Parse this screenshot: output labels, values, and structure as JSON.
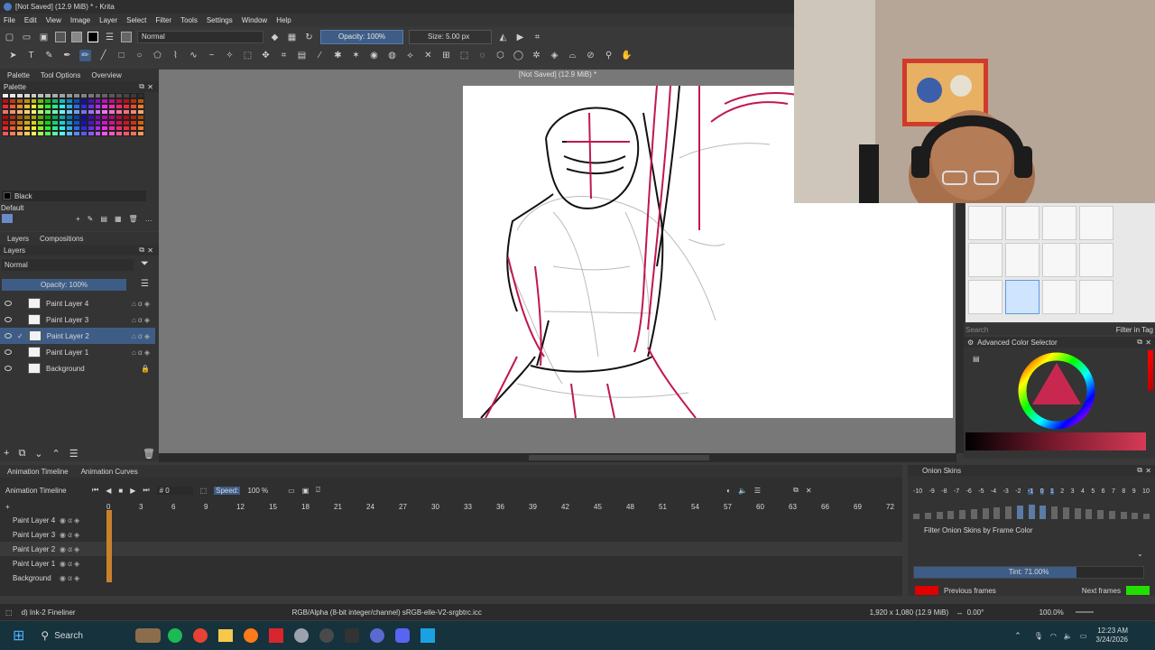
{
  "window": {
    "title": "[Not Saved]  (12.9 MiB) * - Krita"
  },
  "menu": [
    "File",
    "Edit",
    "View",
    "Image",
    "Layer",
    "Select",
    "Filter",
    "Tools",
    "Settings",
    "Window",
    "Help"
  ],
  "toolbar": {
    "blend_mode": "Normal",
    "opacity": "Opacity: 100%",
    "size": "Size: 5.00 px"
  },
  "left_tabs": [
    "Palette",
    "Tool Options",
    "Overview"
  ],
  "palette": {
    "title": "Palette",
    "color_name": "Black",
    "preset": "Default"
  },
  "layers_tabs": [
    "Layers",
    "Compositions"
  ],
  "layers": {
    "title": "Layers",
    "blend": "Normal",
    "opacity": "Opacity:  100%",
    "items": [
      {
        "name": "Paint Layer 4"
      },
      {
        "name": "Paint Layer 3"
      },
      {
        "name": "Paint Layer 2"
      },
      {
        "name": "Paint Layer 1"
      },
      {
        "name": "Background"
      }
    ]
  },
  "canvas": {
    "doc_title": "[Not Saved]  (12.9 MiB) *"
  },
  "timeline": {
    "tabs": [
      "Animation Timeline",
      "Animation Curves"
    ],
    "title": "Animation Timeline",
    "frame": "# 0",
    "speed_label": "Speed:",
    "speed_value": "100 %",
    "ruler": [
      "0",
      "3",
      "6",
      "9",
      "12",
      "15",
      "18",
      "21",
      "24",
      "27",
      "30",
      "33",
      "36",
      "39",
      "42",
      "45",
      "48",
      "51",
      "54",
      "57",
      "60",
      "63",
      "66",
      "69",
      "72"
    ],
    "layers": [
      "Paint Layer 4",
      "Paint Layer 3",
      "Paint Layer 2",
      "Paint Layer 1",
      "Background"
    ]
  },
  "onion": {
    "title": "Onion Skins",
    "numbers": [
      "-10",
      "-9",
      "-8",
      "-7",
      "-6",
      "-5",
      "-4",
      "-3",
      "-2",
      "-1",
      "0",
      "1",
      "2",
      "3",
      "4",
      "5",
      "6",
      "7",
      "8",
      "9",
      "10"
    ],
    "filter_label": "Filter Onion Skins by Frame Color",
    "tint": "Tint: 71.00%",
    "tint_fraction": 0.71,
    "previous": "Previous frames",
    "next": "Next frames",
    "prev_color": "#e00000",
    "next_color": "#22e000"
  },
  "color_selector": {
    "title": "Advanced Color Selector"
  },
  "brush_search": {
    "placeholder": "Search",
    "filter_in_tag": "Filter in Tag"
  },
  "status": {
    "brush": "d) Ink-2 Fineliner",
    "colorspace": "RGB/Alpha (8-bit integer/channel)  sRGB-elle-V2-srgbtrc.icc",
    "dimensions": "1,920 x 1,080 (12.9 MiB)",
    "rotation": "0.00°",
    "zoom": "100.0%"
  },
  "taskbar": {
    "search": "Search",
    "time": "12:23 AM",
    "date": "3/24/2026"
  },
  "colors": {
    "accent": "#3e5d86",
    "sketch_red": "#c01850"
  }
}
